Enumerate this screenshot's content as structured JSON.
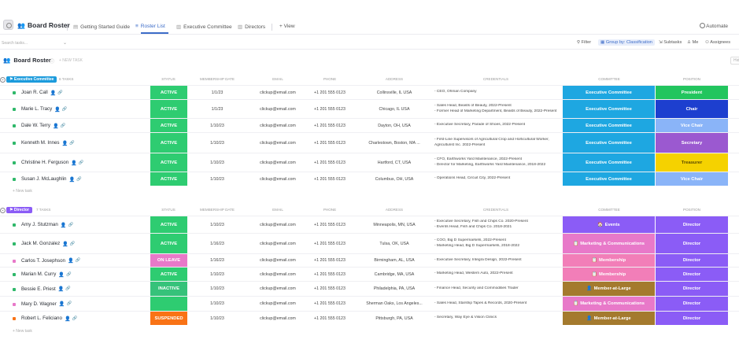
{
  "header": {
    "title": "Board Roster",
    "tabs": [
      {
        "label": "Getting Started Guide",
        "icon": "doc-icon"
      },
      {
        "label": "Roster List",
        "icon": "list-icon"
      },
      {
        "label": "Executive Committee",
        "icon": "board-icon"
      },
      {
        "label": "Directors",
        "icon": "board-icon"
      }
    ],
    "view_label": "+ View",
    "automate_label": "Automate"
  },
  "toolbar": {
    "search_placeholder": "Search tasks...",
    "filter_label": "Filter",
    "group_label": "Group by: Classification",
    "subtasks_label": "Subtasks",
    "me_label": "Me",
    "assignees_label": "Assignees"
  },
  "board": {
    "title": "Board Roster",
    "add_task": "+ NEW TASK",
    "hide": "Hide"
  },
  "columns": [
    "Status",
    "Membership Date",
    "Email",
    "Phone",
    "Address",
    "Credentials",
    "Committee",
    "Position"
  ],
  "groups": [
    {
      "name": "Executive Committee",
      "color": "#1c9bdc",
      "count": "6 TASKS",
      "new_task": "+ New task",
      "rows": [
        {
          "name": "Joan R. Call",
          "bullet": "#2fb86a",
          "status": "Active",
          "date": "1/1/23",
          "email": "clickup@email.com",
          "phone": "+1 201 555 0123",
          "address": "Collinsville, IL USA",
          "credentials": [
            "- CEO, Ohman Company"
          ],
          "committee": "Executive Committee",
          "position": "President"
        },
        {
          "name": "Marie L. Tracy",
          "bullet": "#2fb86a",
          "status": "Active",
          "date": "1/1/23",
          "email": "clickup@email.com",
          "phone": "+1 201 555 0123",
          "address": "Chicago, IL USA",
          "credentials": [
            "- Sales Head, Beasts of Beauty, 2022-Present",
            "- Former Head of Marketing Department, Beasts of Beauty, 2022-Present"
          ],
          "committee": "Executive Committee",
          "position": "Chair"
        },
        {
          "name": "Dale W. Terry",
          "bullet": "#2fb86a",
          "status": "Active",
          "date": "1/10/23",
          "email": "clickup@email.com",
          "phone": "+1 201 555 0123",
          "address": "Dayton, OH, USA",
          "credentials": [
            "- Executive Secretary, Parade of Shoes, 2022-Present"
          ],
          "committee": "Executive Committee",
          "position": "Vice Chair"
        },
        {
          "name": "Kenneth M. Innes",
          "bullet": "#2fb86a",
          "status": "Active",
          "date": "1/10/23",
          "email": "clickup@email.com",
          "phone": "+1 201 555 0123",
          "address": "Charlestown, Boston, MA ...",
          "credentials": [
            "- First-Line Supervisors of Agricultural Crop and Horticultural Worker,",
            "Agriculturist Inc. 2022-Present"
          ],
          "committee": "Executive Committee",
          "position": "Secretary"
        },
        {
          "name": "Christine H. Ferguson",
          "bullet": "#2fb86a",
          "status": "Active",
          "date": "1/10/23",
          "email": "clickup@email.com",
          "phone": "+1 201 555 0123",
          "address": "Hartford, CT, USA",
          "credentials": [
            "- CFO, Earthworks Yard Maintenance, 2022-Present",
            "- Director for Marketing, Earthworks Yard Maintenance, 2018-2022"
          ],
          "committee": "Executive Committee",
          "position": "Treasurer"
        },
        {
          "name": "Susan J. McLaughlin",
          "bullet": "#2fb86a",
          "status": "Active",
          "date": "1/10/23",
          "email": "clickup@email.com",
          "phone": "+1 201 555 0123",
          "address": "Columbus, OH, USA",
          "credentials": [
            "- Operations Head, Circuit City, 2022-Present"
          ],
          "committee": "Executive Committee",
          "position": "Vice Chair"
        }
      ]
    },
    {
      "name": "Director",
      "color": "#8b5cf6",
      "count": "7 TASKS",
      "new_task": "+ New task",
      "rows": [
        {
          "name": "Amy J. Stutzman",
          "bullet": "#2fb86a",
          "status": "Active",
          "date": "1/10/23",
          "email": "clickup@email.com",
          "phone": "+1 201 555 0123",
          "address": "Minneapolis, MN, USA",
          "credentials": [
            "- Executive Secretary, Fish and Chips Co. 2020-Present",
            "- Events Head, Fish and Chips Co. 2018-2021"
          ],
          "committee": "Events",
          "committee_icon": "🏠",
          "position": "Director"
        },
        {
          "name": "Jack M. Gonzalez",
          "bullet": "#2fb86a",
          "status": "Active",
          "date": "1/16/23",
          "email": "clickup@email.com",
          "phone": "+1 201 555 0123",
          "address": "Tulsa, OK, USA",
          "credentials": [
            "- COO, Big D Supermarkets, 2022-Present",
            "- Marketing Head, Big D Supermarkets, 2018-2022"
          ],
          "committee": "Marketing & Communications",
          "committee_icon": "📋",
          "position": "Director"
        },
        {
          "name": "Carlos T. Josephson",
          "bullet": "#e879c9",
          "status": "On Leave",
          "date": "1/16/23",
          "email": "clickup@email.com",
          "phone": "+1 201 555 0123",
          "address": "Birmingham, AL, USA",
          "credentials": [
            "- Executive Secretary, Integra Design, 2022-Present"
          ],
          "committee": "Membership",
          "committee_icon": "📋",
          "position": "Director"
        },
        {
          "name": "Marian M. Curry",
          "bullet": "#2fb86a",
          "status": "Active",
          "date": "1/10/23",
          "email": "clickup@email.com",
          "phone": "+1 201 555 0123",
          "address": "Cambridge, MA, USA",
          "credentials": [
            "- Marketing Head, Western Auto, 2022-Present"
          ],
          "committee": "Membership",
          "committee_icon": "📋",
          "position": "Director"
        },
        {
          "name": "Bessie E. Priest",
          "bullet": "#2fb86a",
          "status": "Inactive",
          "date": "1/10/23",
          "email": "clickup@email.com",
          "phone": "+1 201 555 0123",
          "address": "Philadelphia, PA, USA",
          "credentials": [
            "- Finance Head, Security and Commodities Trader"
          ],
          "committee": "Member-at-Large",
          "committee_icon": "👤",
          "position": "Director"
        },
        {
          "name": "Mary D. Wagner",
          "bullet": "#e879c9",
          "status": "",
          "date": "1/10/23",
          "email": "clickup@email.com",
          "phone": "+1 201 555 0123",
          "address": "Sherman Oaks, Los Angeles...",
          "credentials": [
            "- Sales Head, Starship Tapes & Records, 2020-Present"
          ],
          "committee": "Marketing & Communications",
          "committee_icon": "📋",
          "position": "Director"
        },
        {
          "name": "Robert L. Feliciano",
          "bullet": "#f97316",
          "status": "Suspended",
          "date": "1/10/23",
          "email": "clickup@email.com",
          "phone": "+1 201 555 0123",
          "address": "Pittsburgh, PA, USA",
          "credentials": [
            "- Secretary, Way Eye & Vision Clinics"
          ],
          "committee": "Member-at-Large",
          "committee_icon": "👤",
          "position": "Director"
        }
      ]
    }
  ],
  "colors": {
    "status": {
      "Active": "#2ecc71",
      "On Leave": "#e879c9",
      "Inactive": "#36c27a",
      "Suspended": "#f97316",
      "": "#2ecc71"
    },
    "committee": {
      "Executive Committee": "#1ea7e1",
      "Events": "#8b5cf6",
      "Marketing & Communications": "#e879c9",
      "Membership": "#f27eb8",
      "Member-at-Large": "#a47a2e"
    },
    "position": {
      "President": "#22c55e",
      "Chair": "#1d3fcf",
      "Vice Chair": "#8ab4f8",
      "Secretary": "#9b59d0",
      "Treasurer": "#f5d200",
      "Director": "#8b5cf6"
    }
  }
}
